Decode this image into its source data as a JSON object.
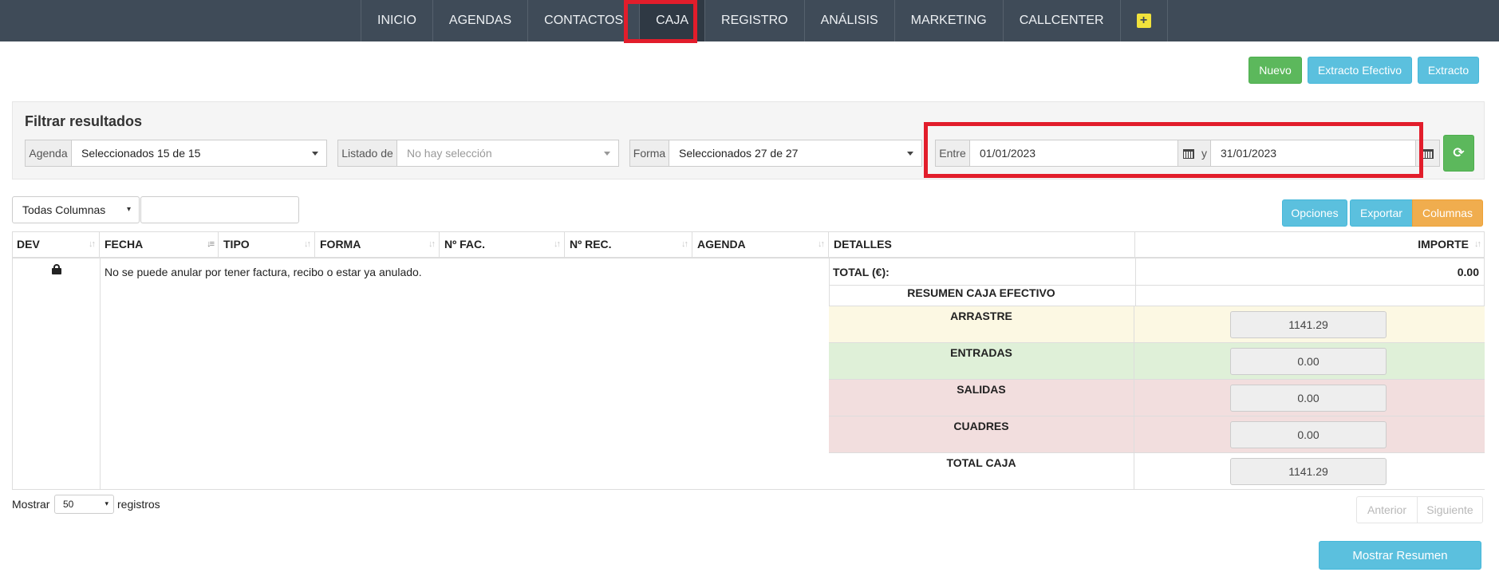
{
  "nav": {
    "items": [
      "INICIO",
      "AGENDAS",
      "CONTACTOS",
      "CAJA",
      "REGISTRO",
      "ANÁLISIS",
      "MARKETING",
      "CALLCENTER"
    ],
    "active": "CAJA",
    "plus": "+"
  },
  "actions": {
    "nuevo": "Nuevo",
    "extracto_efectivo": "Extracto Efectivo",
    "extracto": "Extracto"
  },
  "filter": {
    "title": "Filtrar resultados",
    "agenda_label": "Agenda",
    "agenda_value": "Seleccionados 15 de 15",
    "listado_label": "Listado de",
    "listado_placeholder": "No hay selección",
    "forma_label": "Forma",
    "forma_value": "Seleccionados 27 de 27",
    "entre_label": "Entre",
    "date_from": "01/01/2023",
    "y_label": "y",
    "date_to": "31/01/2023"
  },
  "search": {
    "column_select": "Todas Columnas",
    "value": ""
  },
  "table_buttons": {
    "opciones": "Opciones",
    "exportar": "Exportar",
    "columnas": "Columnas"
  },
  "table": {
    "headers": [
      "DEV",
      "FECHA",
      "TIPO",
      "FORMA",
      "Nº FAC.",
      "Nº REC.",
      "AGENDA",
      "DETALLES",
      "IMPORTE"
    ],
    "row_note": "No se puede anular por tener factura, recibo o estar ya anulado.",
    "total_label": "TOTAL (€):",
    "total_value": "0.00"
  },
  "summary": {
    "title": "RESUMEN CAJA EFECTIVO",
    "rows": [
      {
        "label": "ARRASTRE",
        "value": "1141.29",
        "color": "#fcf8e3"
      },
      {
        "label": "ENTRADAS",
        "value": "0.00",
        "color": "#dff0d8"
      },
      {
        "label": "SALIDAS",
        "value": "0.00",
        "color": "#f2dede"
      },
      {
        "label": "CUADRES",
        "value": "0.00",
        "color": "#f2dede"
      },
      {
        "label": "TOTAL CAJA",
        "value": "1141.29",
        "color": "#ffffff"
      }
    ]
  },
  "footer": {
    "mostrar": "Mostrar",
    "page_size": "50",
    "registros": "registros",
    "anterior": "Anterior",
    "siguiente": "Siguiente",
    "mostrar_resumen": "Mostrar Resumen"
  }
}
